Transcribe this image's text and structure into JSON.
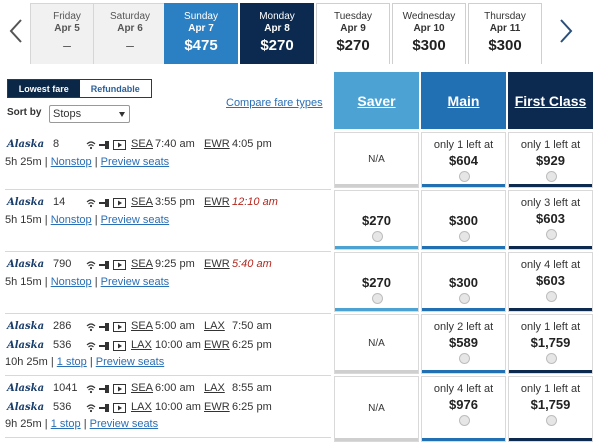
{
  "date_strip": {
    "days": [
      {
        "name": "Friday",
        "date": "Apr 5",
        "price": "–"
      },
      {
        "name": "Saturday",
        "date": "Apr 6",
        "price": "–"
      },
      {
        "name": "Sunday",
        "date": "Apr 7",
        "price": "$475"
      },
      {
        "name": "Monday",
        "date": "Apr 8",
        "price": "$270"
      },
      {
        "name": "Tuesday",
        "date": "Apr 9",
        "price": "$270"
      },
      {
        "name": "Wednesday",
        "date": "Apr 10",
        "price": "$300"
      },
      {
        "name": "Thursday",
        "date": "Apr 11",
        "price": "$300"
      }
    ]
  },
  "fare_toggle": {
    "lowest": "Lowest fare",
    "refundable": "Refundable"
  },
  "sort": {
    "label": "Sort by",
    "value": "Stops"
  },
  "compare_link": "Compare fare types",
  "columns": {
    "saver": "Saver",
    "main": "Main",
    "first": "First Class"
  },
  "airline": "Alaska",
  "flights": [
    {
      "segments": [
        {
          "number": "8",
          "from": "SEA",
          "dep": "7:40 am",
          "to": "EWR",
          "arr": "4:05 pm",
          "arr_late": false
        }
      ],
      "duration": "5h 25m",
      "stops": "Nonstop",
      "preview": "Preview seats",
      "saver": {
        "na": "N/A"
      },
      "main": {
        "seats": "only 1 left at",
        "price": "$604"
      },
      "first": {
        "seats": "only 1 left at",
        "price": "$929"
      }
    },
    {
      "segments": [
        {
          "number": "14",
          "from": "SEA",
          "dep": "3:55 pm",
          "to": "EWR",
          "arr": "12:10 am",
          "arr_late": true
        }
      ],
      "duration": "5h 15m",
      "stops": "Nonstop",
      "preview": "Preview seats",
      "saver": {
        "price": "$270"
      },
      "main": {
        "price": "$300"
      },
      "first": {
        "seats": "only 3 left at",
        "price": "$603"
      }
    },
    {
      "segments": [
        {
          "number": "790",
          "from": "SEA",
          "dep": "9:25 pm",
          "to": "EWR",
          "arr": "5:40 am",
          "arr_late": true
        }
      ],
      "duration": "5h 15m",
      "stops": "Nonstop",
      "preview": "Preview seats",
      "saver": {
        "price": "$270"
      },
      "main": {
        "price": "$300"
      },
      "first": {
        "seats": "only 4 left at",
        "price": "$603"
      }
    },
    {
      "segments": [
        {
          "number": "286",
          "from": "SEA",
          "dep": "5:00 am",
          "to": "LAX",
          "arr": "7:50 am",
          "arr_late": false
        },
        {
          "number": "536",
          "from": "LAX",
          "dep": "10:00 am",
          "to": "EWR",
          "arr": "6:25 pm",
          "arr_late": false
        }
      ],
      "duration": "10h 25m",
      "stops": "1 stop",
      "preview": "Preview seats",
      "saver": {
        "na": "N/A"
      },
      "main": {
        "seats": "only 2 left at",
        "price": "$589"
      },
      "first": {
        "seats": "only 1 left at",
        "price": "$1,759"
      }
    },
    {
      "segments": [
        {
          "number": "1041",
          "from": "SEA",
          "dep": "6:00 am",
          "to": "LAX",
          "arr": "8:55 am",
          "arr_late": false
        },
        {
          "number": "536",
          "from": "LAX",
          "dep": "10:00 am",
          "to": "EWR",
          "arr": "6:25 pm",
          "arr_late": false
        }
      ],
      "duration": "9h 25m",
      "stops": "1 stop",
      "preview": "Preview seats",
      "saver": {
        "na": "N/A"
      },
      "main": {
        "seats": "only 4 left at",
        "price": "$976"
      },
      "first": {
        "seats": "only 1 left at",
        "price": "$1,759"
      }
    }
  ]
}
